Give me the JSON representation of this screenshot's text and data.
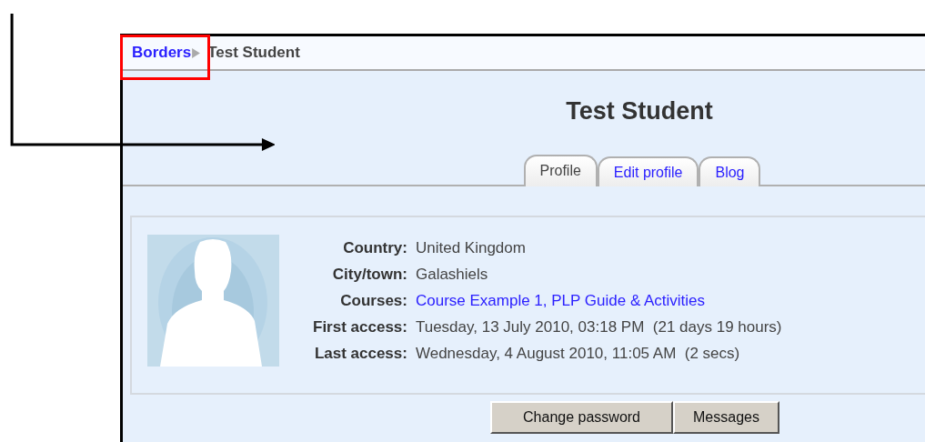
{
  "breadcrumb": [
    {
      "label": "Borders",
      "kind": "link"
    },
    {
      "label": "Test Student",
      "kind": "current"
    }
  ],
  "heading": "Test Student",
  "tabs": [
    {
      "label": "Profile",
      "selected": true
    },
    {
      "label": "Edit profile",
      "selected": false
    },
    {
      "label": "Blog",
      "selected": false
    }
  ],
  "profile": {
    "fields": [
      {
        "label": "Country:",
        "value": "United Kingdom",
        "kind": "text"
      },
      {
        "label": "City/town:",
        "value": "Galashiels",
        "kind": "text"
      },
      {
        "label": "Courses:",
        "value": "Course Example 1, PLP Guide & Activities",
        "kind": "link"
      },
      {
        "label": "First access:",
        "value": "Tuesday, 13 July 2010, 03:18 PM  (21 days 19 hours)",
        "kind": "text"
      },
      {
        "label": "Last access:",
        "value": "Wednesday, 4 August 2010, 11:05 AM  (2 secs)",
        "kind": "text"
      }
    ]
  },
  "buttons": [
    "Change password",
    "Messages"
  ]
}
